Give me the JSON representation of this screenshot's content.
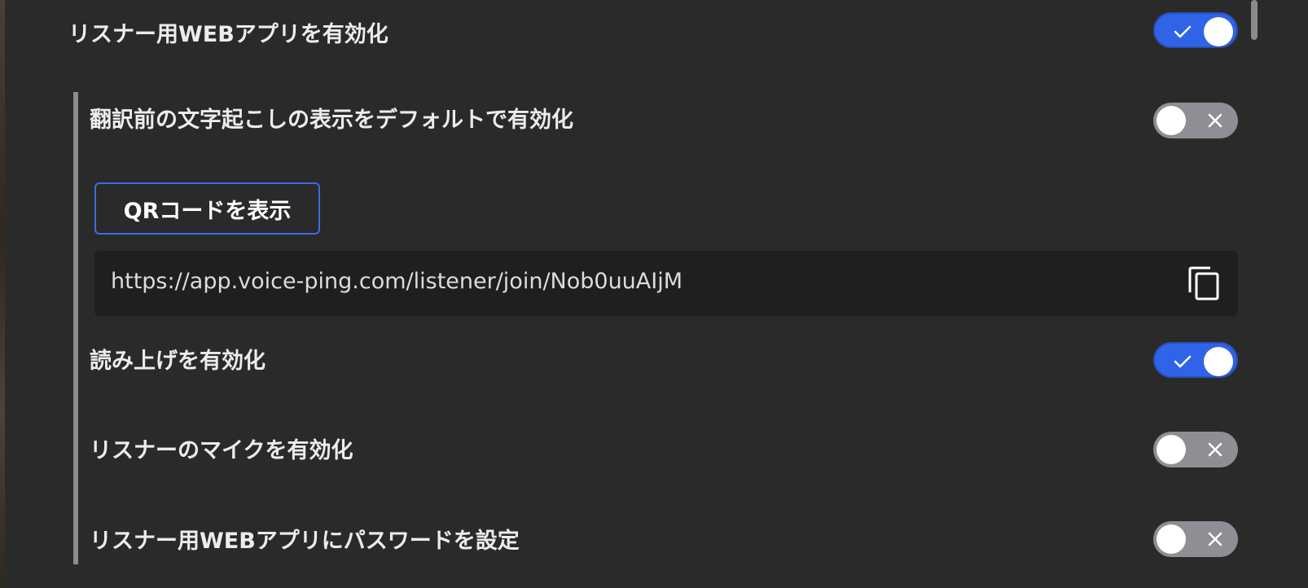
{
  "settings": {
    "web_app_enable": {
      "label": "リスナー用WEBアプリを有効化",
      "state": "on"
    },
    "show_original_transcript": {
      "label": "翻訳前の文字起こしの表示をデフォルトで有効化",
      "state": "off"
    },
    "qr_button_label": "QRコードを表示",
    "listener_url": "https://app.voice-ping.com/listener/join/Nob0uuAIjM",
    "read_aloud": {
      "label": "読み上げを有効化",
      "state": "on"
    },
    "listener_mic": {
      "label": "リスナーのマイクを有効化",
      "state": "off"
    },
    "password": {
      "label": "リスナー用WEBアプリにパスワードを設定",
      "state": "off"
    }
  },
  "icons": {
    "toggle_on": "check-icon",
    "toggle_off": "close-icon",
    "copy": "copy-icon"
  },
  "colors": {
    "panel_background": "#2a2a2a",
    "toggle_on": "#2f63e8",
    "toggle_off": "#8e8e95",
    "accent_border": "#3f6ae4",
    "url_background": "#1f1f1f",
    "text": "#ececec"
  }
}
